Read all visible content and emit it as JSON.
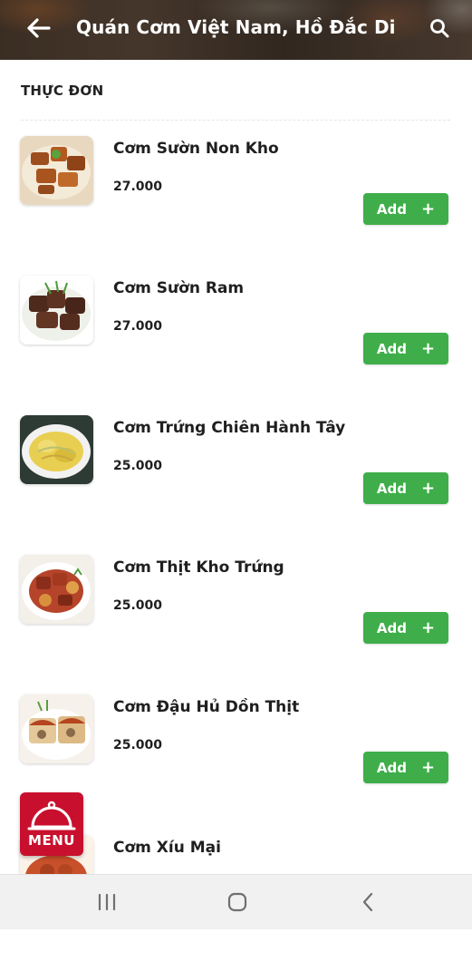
{
  "header": {
    "title": "Quán Cơm Việt Nam, Hồ Đắc Di",
    "back_icon": "arrow-left-icon",
    "search_icon": "search-icon"
  },
  "menu": {
    "section_title": "THỰC ĐƠN",
    "add_label": "Add",
    "items": [
      {
        "name": "Cơm Sườn Non Kho",
        "price": "27.000"
      },
      {
        "name": "Cơm Sườn Ram",
        "price": "27.000"
      },
      {
        "name": "Cơm Trứng Chiên Hành Tây",
        "price": "25.000"
      },
      {
        "name": "Cơm Thịt Kho Trứng",
        "price": "25.000"
      },
      {
        "name": "Cơm Đậu Hủ Dồn Thịt",
        "price": "25.000"
      },
      {
        "name": "Cơm Xíu Mại",
        "price": ""
      }
    ]
  },
  "menu_badge": {
    "label": "MENU",
    "icon": "cloche-icon"
  },
  "nav": {
    "recents_icon": "recents-icon",
    "home_icon": "home-icon",
    "back_icon": "chevron-left-icon"
  },
  "colors": {
    "accent_green": "#3fae4a",
    "menu_red": "#c8102e",
    "header_overlay": "#4c3d31"
  }
}
